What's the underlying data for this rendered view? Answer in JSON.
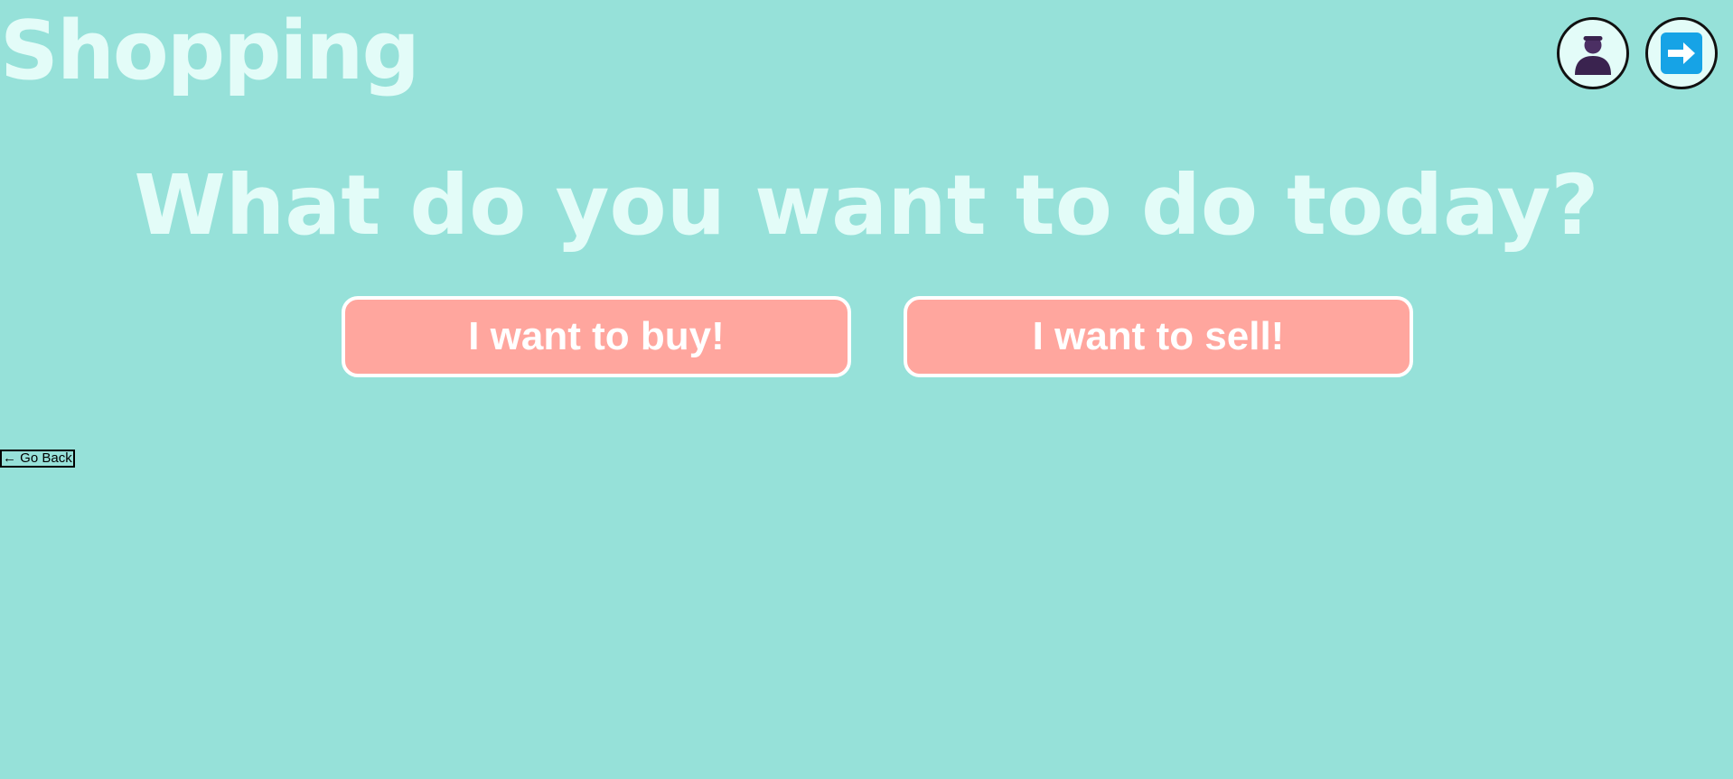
{
  "header": {
    "title": "Shopping",
    "profile_icon": "user-avatar-icon",
    "logout_icon": "arrow-right-icon"
  },
  "main": {
    "headline": "What do you want to do today?",
    "buy_label": "I want to buy!",
    "sell_label": "I want to sell!"
  },
  "footer": {
    "back_label": "← Go Back"
  },
  "colors": {
    "background": "#96e1d9",
    "title_text": "#e3fcf8",
    "button_fill": "#ffa69e",
    "button_border": "#ffffff",
    "logout_icon_bg": "#16a3e6",
    "avatar_color": "#4b2f63"
  }
}
